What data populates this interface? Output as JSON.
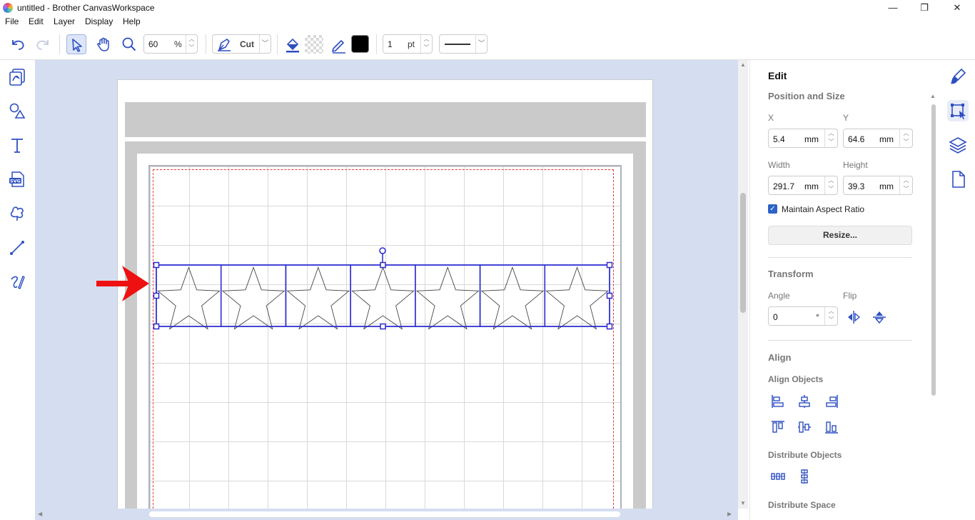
{
  "window": {
    "title": "untitled - Brother CanvasWorkspace",
    "controls": {
      "minimize": "—",
      "maximize": "❐",
      "close": "✕"
    }
  },
  "menu": {
    "items": [
      "File",
      "Edit",
      "Layer",
      "Display",
      "Help"
    ]
  },
  "toolbar": {
    "zoom_value": "60",
    "zoom_unit": "%",
    "mode_label": "Cut",
    "line_width_value": "1",
    "line_width_unit": "pt",
    "line_color": "#000000",
    "icons": [
      "undo-icon",
      "redo-icon",
      "select-arrow-icon",
      "hand-pan-icon",
      "zoom-magnifier-icon",
      "pen-cut-icon",
      "fill-bucket-icon",
      "transparent-fill-icon",
      "line-pen-icon"
    ]
  },
  "left_tools": [
    "templates-icon",
    "shapes-icon",
    "text-icon",
    "svg-import-icon",
    "shape-library-icon",
    "line-tool-icon",
    "freehand-tool-icon"
  ],
  "canvas": {
    "accent_color": "#2a2ad0",
    "cut_border_color": "#e53b3b",
    "arrow_color": "#ee1111",
    "star_count": 7
  },
  "panel": {
    "title": "Edit",
    "position_size": {
      "heading": "Position and Size",
      "x_label": "X",
      "x_value": "5.4",
      "x_unit": "mm",
      "y_label": "Y",
      "y_value": "64.6",
      "y_unit": "mm",
      "width_label": "Width",
      "width_value": "291.7",
      "width_unit": "mm",
      "height_label": "Height",
      "height_value": "39.3",
      "height_unit": "mm",
      "maintain_aspect_label": "Maintain Aspect Ratio",
      "maintain_aspect_checked": true,
      "resize_label": "Resize..."
    },
    "transform": {
      "heading": "Transform",
      "angle_label": "Angle",
      "angle_value": "0",
      "angle_unit": "°",
      "flip_label": "Flip"
    },
    "align": {
      "heading": "Align",
      "align_objects_label": "Align Objects",
      "distribute_objects_label": "Distribute Objects",
      "distribute_space_label": "Distribute Space"
    }
  },
  "right_tabs": [
    "paint-brush-icon",
    "edit-transform-icon",
    "layers-icon",
    "page-icon"
  ]
}
